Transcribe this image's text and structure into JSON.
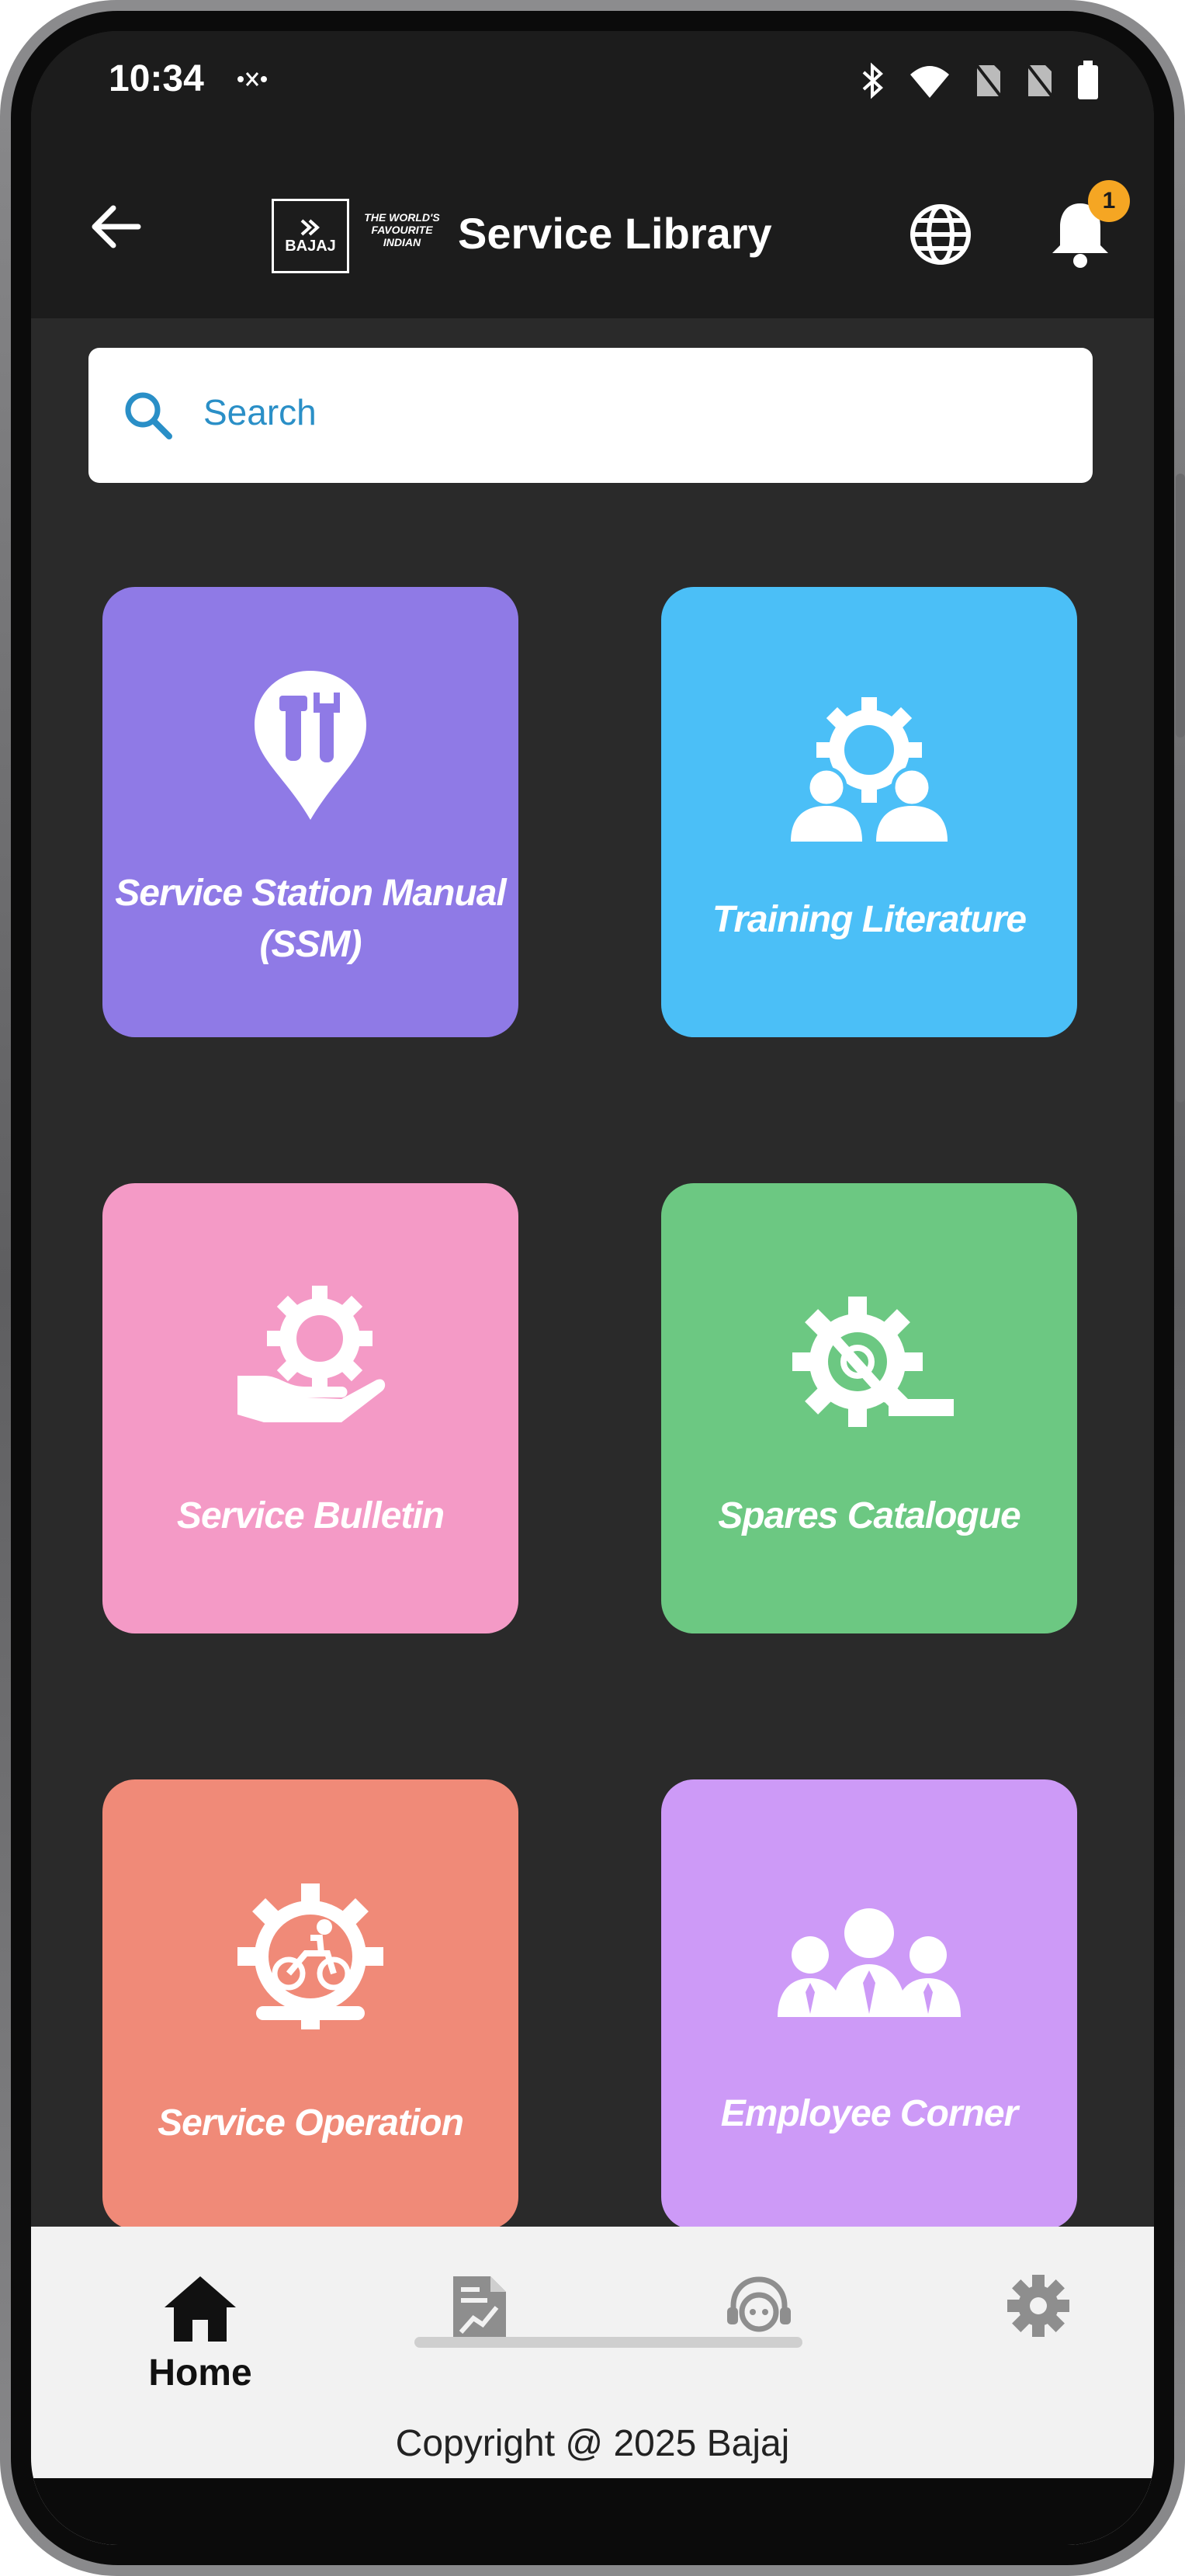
{
  "status_bar": {
    "time": "10:34",
    "left_icon": "signal-glyph-icon",
    "right_icons": [
      "bluetooth-icon",
      "wifi-icon",
      "no-sim-icon",
      "no-sim-icon",
      "battery-icon"
    ]
  },
  "app_bar": {
    "title": "Service Library",
    "logo_text": "BAJAJ",
    "logo_tagline": "THE WORLD'S FAVOURITE INDIAN",
    "notification_count": "1",
    "accent": "#f5a623"
  },
  "search": {
    "placeholder": "Search"
  },
  "tiles": [
    {
      "label_line1": "Service Station Manual",
      "label_line2": "(SSM)",
      "color": "#8f7ae6",
      "icon": "wrench-pin-icon"
    },
    {
      "label_line1": "Training Literature",
      "color": "#4bbff7",
      "icon": "gear-people-icon"
    },
    {
      "label_line1": "Service Bulletin",
      "color": "#f49ac6",
      "icon": "gear-hand-icon"
    },
    {
      "label_line1": "Spares Catalogue",
      "color": "#6cc882",
      "icon": "gear-tool-icon"
    },
    {
      "label_line1": "Service Operation",
      "color": "#f08a78",
      "icon": "gear-bike-icon"
    },
    {
      "label_line1": "Employee Corner",
      "color": "#cd9af7",
      "icon": "employees-icon"
    }
  ],
  "bottom_nav": {
    "items": [
      {
        "label": "Home",
        "icon": "home-icon",
        "active": true
      },
      {
        "label": "",
        "icon": "report-icon"
      },
      {
        "label": "",
        "icon": "support-agent-icon"
      },
      {
        "label": "",
        "icon": "settings-icon"
      }
    ],
    "copyright": "Copyright @ 2025 Bajaj"
  }
}
